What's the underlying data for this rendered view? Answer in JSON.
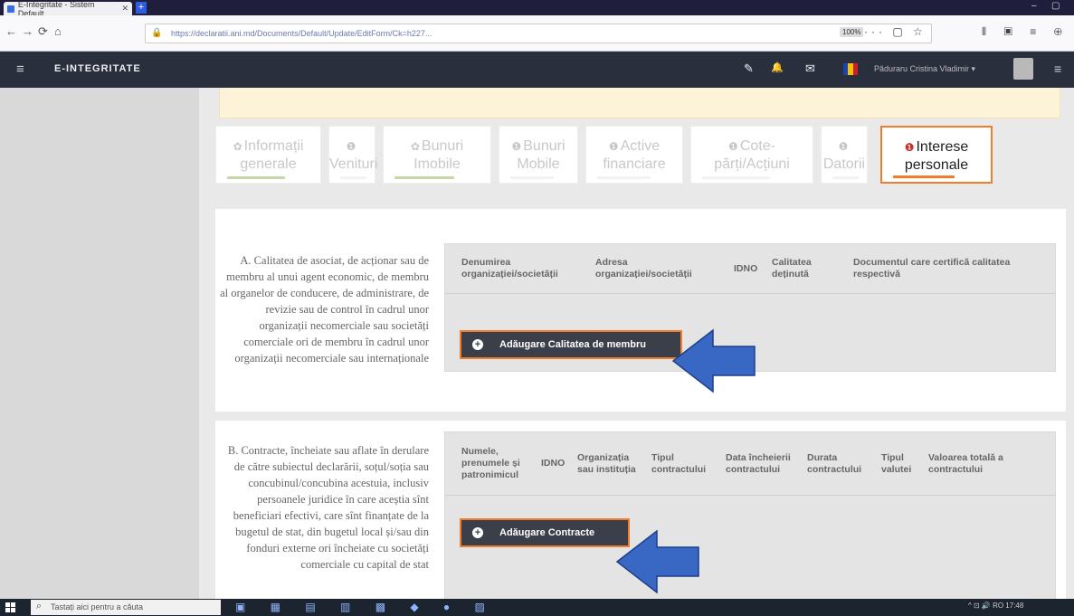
{
  "browser": {
    "tab_title": "E-Integritate - Sistem Default",
    "tab_close": "✕",
    "new_tab": "+",
    "url": "https://declaratii.ani.md/Documents/Default/Update/EditForm/Ck=h227...",
    "zoom": "100%",
    "url_icons": "··· ▢ ☆",
    "right_icons": "⫴ ▣ ≡ ⊕",
    "win_min": "–",
    "win_max": "▢",
    "nav_back": "←",
    "nav_fwd": "→",
    "nav_reload": "⟳",
    "nav_home": "⌂",
    "lock": "🔒"
  },
  "header": {
    "brand": "E-INTEGRITATE",
    "menu_icon": "≡",
    "icons": {
      "wrench": "✎",
      "bell": "🔔",
      "mail": "✉",
      "menu": "≡"
    },
    "user": "Păduraru Cristina Vladimir ▾"
  },
  "colors": {
    "accent": "#f07c2c",
    "arrow_fill": "#3867c4",
    "header_bg": "#2a2f3e",
    "flag_blue": "#1a44b3",
    "flag_yellow": "#f2c200",
    "flag_red": "#cc1f2d"
  },
  "form_tabs": [
    {
      "mark": "✿",
      "line1": "Informații",
      "line2": "generale",
      "bar": "#c4d8a5",
      "active": false
    },
    {
      "mark": "❶",
      "line1": "",
      "line2": "Venituri",
      "bar": "#f2f2f2",
      "active": false
    },
    {
      "mark": "✿",
      "line1": "Bunuri",
      "line2": "Imobile",
      "bar": "#c4d8a5",
      "active": false
    },
    {
      "mark": "❶",
      "line1": "Bunuri",
      "line2": "Mobile",
      "bar": "#f2f2f2",
      "active": false
    },
    {
      "mark": "❶",
      "line1": "Active",
      "line2": "financiare",
      "bar": "#f2f2f2",
      "active": false
    },
    {
      "mark": "❶",
      "line1": "Cote-",
      "line2": "părți/Acțiuni",
      "bar": "#f2f2f2",
      "active": false
    },
    {
      "mark": "❶",
      "line1": "",
      "line2": "Datorii",
      "bar": "#f2f2f2",
      "active": false
    },
    {
      "mark": "❶",
      "line1": "Interese",
      "line2": "personale",
      "bar": "#f07c2c",
      "active": true
    }
  ],
  "section_a": {
    "label": "A. Calitatea de asociat, de acționar sau de membru al unui agent economic, de membru al organelor de conducere, de administrare, de revizie sau de control în cadrul unor organizații necomerciale sau societăți comerciale ori de membru în cadrul unor organizații necomerciale sau internaționale",
    "columns": [
      "Denumirea organizației/societății",
      "Adresa organizației/societății",
      "IDNO",
      "Calitatea deținută",
      "Documentul care certifică calitatea respectivă"
    ],
    "button": "Adăugare Calitatea de membru"
  },
  "section_b": {
    "label": "B. Contracte, încheiate sau aflate în derulare de către subiectul declarării, soțul/soția sau concubinul/concubina acestuia, inclusiv persoanele juridice în care aceștia sînt beneficiari efectivi, care sînt finanțate de la bugetul de stat, din bugetul local și/sau din fonduri externe ori încheiate cu societăți comerciale cu capital de stat",
    "columns": [
      "Numele, prenumele și patronimicul",
      "IDNO",
      "Organizația sau instituția",
      "Tipul contractului",
      "Data încheierii contractului",
      "Durata contractului",
      "Tipul valutei",
      "Valoarea totală a contractului"
    ],
    "button": "Adăugare Contracte"
  },
  "taskbar": {
    "search": "Tastați aici pentru a căuta",
    "tray": "^ ⊡ 🔊 RO 17:48"
  }
}
